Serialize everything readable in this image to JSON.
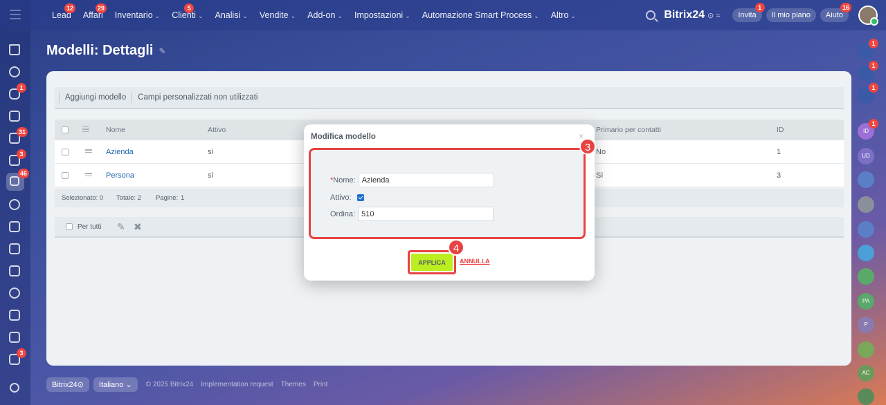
{
  "topbar": {
    "nav": [
      {
        "label": "Lead",
        "badge": "12",
        "chevron": false
      },
      {
        "label": "Affari",
        "badge": "29",
        "chevron": false
      },
      {
        "label": "Inventario",
        "badge": "",
        "chevron": true
      },
      {
        "label": "Clienti",
        "badge": "5",
        "chevron": true
      },
      {
        "label": "Analisi",
        "badge": "",
        "chevron": true
      },
      {
        "label": "Vendite",
        "badge": "",
        "chevron": true
      },
      {
        "label": "Add-on",
        "badge": "",
        "chevron": true
      },
      {
        "label": "Impostazioni",
        "badge": "",
        "chevron": true
      },
      {
        "label": "Automazione Smart Process",
        "badge": "",
        "chevron": true
      },
      {
        "label": "Altro",
        "badge": "",
        "chevron": true
      }
    ],
    "brand": "Bitrix24",
    "brand_sub": "⊙ ≈",
    "invite": {
      "label": "Invita",
      "badge": "1"
    },
    "plan": "Il mio piano",
    "help": {
      "label": "Aiuto",
      "badge": "16"
    }
  },
  "left_rail_badges": {
    "chat": "1",
    "tasks": "31",
    "mail": "3",
    "crm": "46",
    "forms": "3"
  },
  "right_rail": [
    {
      "label": "",
      "badge": "1",
      "color": "#3a5aa8"
    },
    {
      "label": "",
      "badge": "1",
      "color": "#3a5aa8"
    },
    {
      "label": "",
      "badge": "1",
      "color": "#3a5aa8"
    },
    {
      "label": "ID",
      "badge": "1",
      "color": "#9b6fd6"
    },
    {
      "label": "UD",
      "badge": "",
      "color": "#7b6fc6"
    },
    {
      "label": "",
      "badge": "",
      "color": "#5b7fc6"
    },
    {
      "label": "",
      "badge": "",
      "color": "#8a8f9a"
    },
    {
      "label": "",
      "badge": "",
      "color": "#5b7fc6"
    },
    {
      "label": "",
      "badge": "",
      "color": "#4a9fd6"
    },
    {
      "label": "",
      "badge": "",
      "color": "#5aa86a"
    },
    {
      "label": "PA",
      "badge": "",
      "color": "#5aa86a"
    },
    {
      "label": "P",
      "badge": "",
      "color": "#8a7ab0"
    },
    {
      "label": "",
      "badge": "",
      "color": "#7aa85a"
    },
    {
      "label": "AC",
      "badge": "",
      "color": "#6a9a5a"
    },
    {
      "label": "",
      "badge": "",
      "color": "#5a8a5a"
    }
  ],
  "page": {
    "title": "Modelli: Dettagli"
  },
  "toolbar": {
    "add_model": "Aggiungi modello",
    "unused_fields": "Campi personalizzati non utilizzati"
  },
  "grid": {
    "columns": {
      "name": "Nome",
      "active": "Attivo",
      "primary": "Primario per contatti",
      "id": "ID"
    },
    "rows": [
      {
        "name": "Azienda",
        "active": "sì",
        "primary": "No",
        "id": "1"
      },
      {
        "name": "Persona",
        "active": "sì",
        "primary": "Sì",
        "id": "3"
      }
    ],
    "footer": {
      "selected": "Selezionato: 0",
      "total": "Totale: 2",
      "pages": "Pagine:",
      "page_num": "1"
    },
    "for_all": "Per tutti"
  },
  "dialog": {
    "title": "Modifica modello",
    "close": "×",
    "name_label": "Nome:",
    "name_value": "Azienda",
    "active_label": "Attivo:",
    "order_label": "Ordina:",
    "order_value": "510",
    "apply": "APPLICA",
    "cancel": "ANNULLA",
    "step_form": "3",
    "step_apply": "4"
  },
  "footer": {
    "brand": "Bitrix24⊙",
    "language": "Italiano",
    "copyright": "© 2025 Bitrix24",
    "impl": "Implementation request",
    "themes": "Themes",
    "print": "Print"
  },
  "colors": {
    "accent_red": "#e84242",
    "apply_green": "#bbed21",
    "link_blue": "#2067b0"
  }
}
